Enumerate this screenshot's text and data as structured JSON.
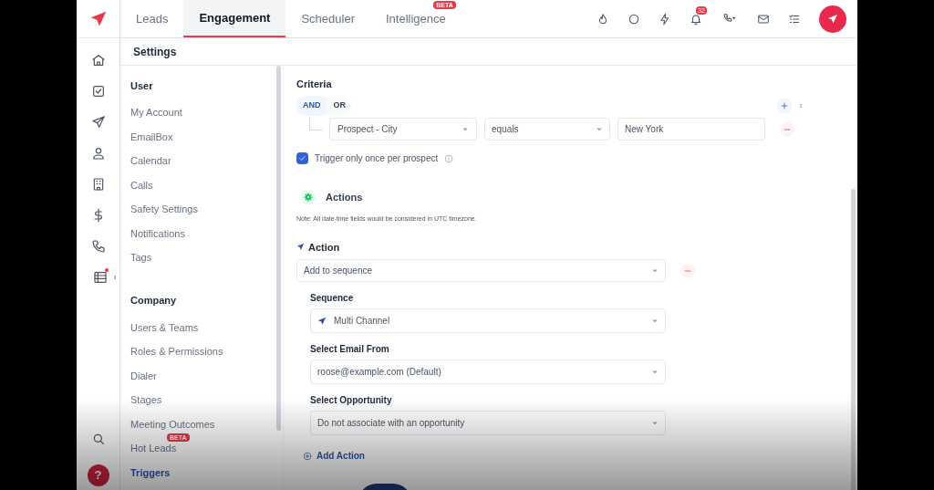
{
  "top_tabs": [
    {
      "label": "Leads",
      "selected": false
    },
    {
      "label": "Engagement",
      "selected": true
    },
    {
      "label": "Scheduler",
      "selected": false
    },
    {
      "label": "Intelligence",
      "selected": false,
      "badge": "BETA"
    }
  ],
  "notification_count": "32",
  "help_label": "?",
  "page_title": "Settings",
  "sidebar": [
    {
      "heading": "User",
      "items": [
        {
          "label": "My Account",
          "selected": false
        },
        {
          "label": "EmailBox",
          "selected": false
        },
        {
          "label": "Calendar",
          "selected": false
        },
        {
          "label": "Calls",
          "selected": false
        },
        {
          "label": "Safety Settings",
          "selected": false
        },
        {
          "label": "Notifications",
          "selected": false
        },
        {
          "label": "Tags",
          "selected": false
        }
      ]
    },
    {
      "heading": "Company",
      "items": [
        {
          "label": "Users & Teams",
          "selected": false
        },
        {
          "label": "Roles & Permissions",
          "selected": false
        },
        {
          "label": "Dialer",
          "selected": false
        },
        {
          "label": "Stages",
          "selected": false
        },
        {
          "label": "Meeting Outcomes",
          "selected": false
        },
        {
          "label": "Hot Leads",
          "selected": false,
          "badge": "BETA"
        },
        {
          "label": "Triggers",
          "selected": true
        }
      ]
    }
  ],
  "criteria": {
    "title": "Criteria",
    "operators": [
      {
        "label": "AND",
        "selected": true
      },
      {
        "label": "OR",
        "selected": false
      }
    ],
    "conditions": [
      {
        "field": "Prospect - City",
        "operator": "equals",
        "value": "New York"
      }
    ],
    "once_checkbox": {
      "label": "Trigger only once per prospect",
      "checked": true
    }
  },
  "actions": {
    "title": "Actions",
    "note": "Note: All date-time fields would be considered in UTC timezone.",
    "action_label": "Action",
    "action_value": "Add to sequence",
    "fields": [
      {
        "label": "Sequence",
        "value": "Multi Channel",
        "kind": "icon-select"
      },
      {
        "label": "Select Email From",
        "value": "roose@example.com (Default)",
        "kind": "select"
      },
      {
        "label": "Select Opportunity",
        "value": "Do not associate with an opportunity",
        "kind": "select"
      }
    ],
    "add_action": "Add Action"
  }
}
